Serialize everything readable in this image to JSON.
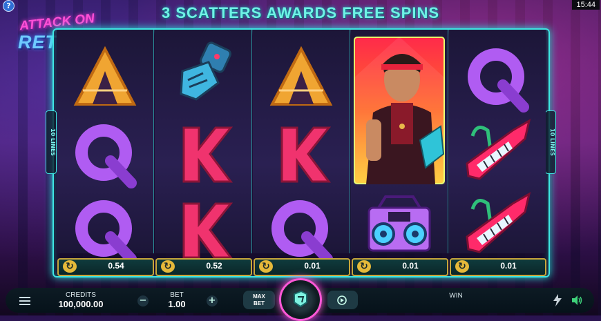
{
  "game": {
    "logo_line1": "ATTACK ON",
    "logo_line2": "RETRO",
    "banner": "3 SCATTERS AWARDS FREE SPINS",
    "lines_label": "10 LINES"
  },
  "system": {
    "help": "?",
    "time": "15:44"
  },
  "reels": [
    {
      "symbols": [
        "triangle-a-icon",
        "q-icon",
        "q-icon"
      ],
      "win": "0.54"
    },
    {
      "symbols": [
        "gauntlet-icon",
        "k-icon",
        "k-icon"
      ],
      "win": "0.52"
    },
    {
      "symbols": [
        "triangle-a-icon",
        "k-icon",
        "q-icon"
      ],
      "win": "0.01"
    },
    {
      "symbols": [
        "hero-wild-icon",
        "boombox-icon"
      ],
      "win": "0.01"
    },
    {
      "symbols": [
        "q-icon",
        "keytar-icon",
        "keytar-icon"
      ],
      "win": "0.01"
    }
  ],
  "controls": {
    "credits_label": "CREDITS",
    "credits_value": "100,000.00",
    "bet_label": "BET",
    "bet_value": "1.00",
    "minus": "−",
    "plus": "+",
    "maxbet_line1": "MAX",
    "maxbet_line2": "BET",
    "win_label": "WIN"
  },
  "colors": {
    "accent": "#3ee6e2",
    "spin_ring": "#ff58d8",
    "win_frame": "#c8a63a"
  }
}
